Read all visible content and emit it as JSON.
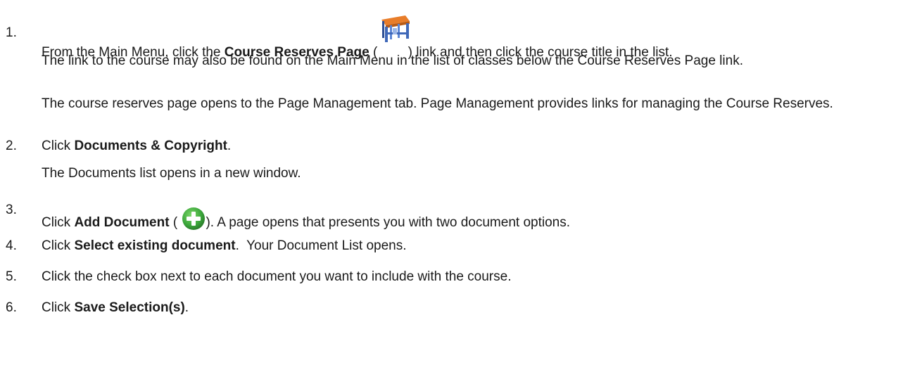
{
  "steps": [
    {
      "num": "1.",
      "pre": "From the Main Menu, click the ",
      "bold": "Course Reserves Page",
      "mid": " ( ",
      "icon": "course-reserves-desk-icon",
      "post": ") link and then click the course title in the list.",
      "notes": [
        "The link to the course may also be found on the Main Menu in the list of classes below the Course Reserves Page link.",
        "The course reserves page opens to the Page Management tab. Page Management provides links for managing the Course Reserves."
      ]
    },
    {
      "num": "2.",
      "pre": "Click ",
      "bold": "Documents & Copyright",
      "post": ".",
      "notes": [
        "The Documents list opens in a new window."
      ]
    },
    {
      "num": "3.",
      "pre": "Click ",
      "bold": "Add Document",
      "mid": " ( ",
      "icon": "add-plus-icon",
      "post": "). A page opens that presents you with two document options."
    },
    {
      "num": "4.",
      "pre": "Click ",
      "bold": "Select existing document",
      "post": ".  Your Document List opens."
    },
    {
      "num": "5.",
      "pre": "Click the check box next to each document you want to include with the course."
    },
    {
      "num": "6.",
      "pre": "Click ",
      "bold": "Save Selection(s)",
      "post": "."
    }
  ],
  "colors": {
    "text": "#1a1a1a",
    "plus_icon_green": "#3aa53a",
    "desk_top": "#e87d2a",
    "desk_legs": "#3f68b8"
  }
}
